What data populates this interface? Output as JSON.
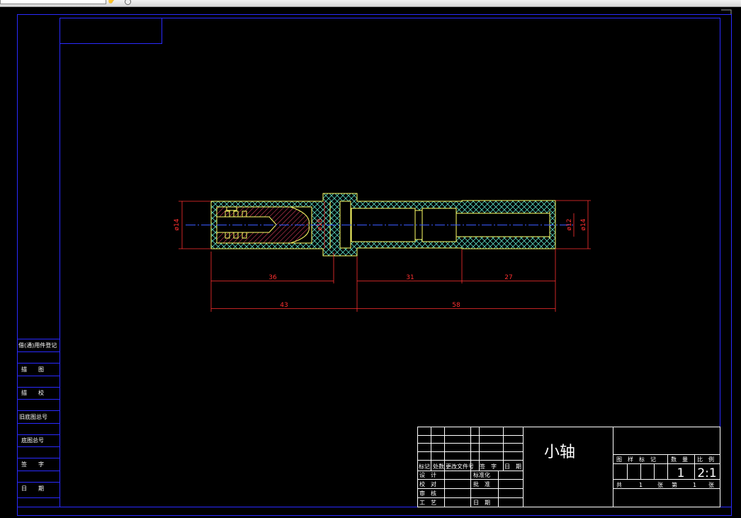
{
  "toolbar": {
    "icons": [
      "pan-icon",
      "zoom-icon"
    ]
  },
  "drawing": {
    "dimensions": {
      "dia_left": "ø14",
      "dia_mid": "ø18",
      "dia_right_inner": "ø12",
      "dia_right_outer": "ø14",
      "len_36": "36",
      "len_31": "31",
      "len_27": "27",
      "len_43": "43",
      "len_58": "58"
    }
  },
  "side_table": {
    "rows": [
      "借(通)用件登记",
      "描　　图",
      "描　　校",
      "旧底图总号",
      "底图总号",
      "签　　字",
      "日　　期"
    ]
  },
  "title_block": {
    "part_name": "小轴",
    "revision_headers": [
      "标记",
      "处数",
      "更改文件号",
      "签　字",
      "日　期"
    ],
    "roles": {
      "design": "设　计",
      "check": "校　对",
      "review": "审　核",
      "process": "工　艺",
      "standardize": "标准化",
      "approve": "批　准",
      "date": "日　期"
    },
    "info_headers": {
      "stage_mark": "图　样　标　记",
      "quantity": "数　量",
      "scale": "比　例"
    },
    "quantity": "1",
    "scale": "2:1",
    "sheets_total_label": "共",
    "sheets_total": "1",
    "sheet_label": "张",
    "sheet_no_label": "第",
    "sheet_no": "1",
    "sheet_no_suffix": "张"
  },
  "colors": {
    "border": "#2a2aff",
    "dimension": "#ff3030",
    "outline": "#ffff66",
    "hatch": "#5ad6c0",
    "section_hatch": "#ff4a6e",
    "centerline": "#3a5aff"
  }
}
